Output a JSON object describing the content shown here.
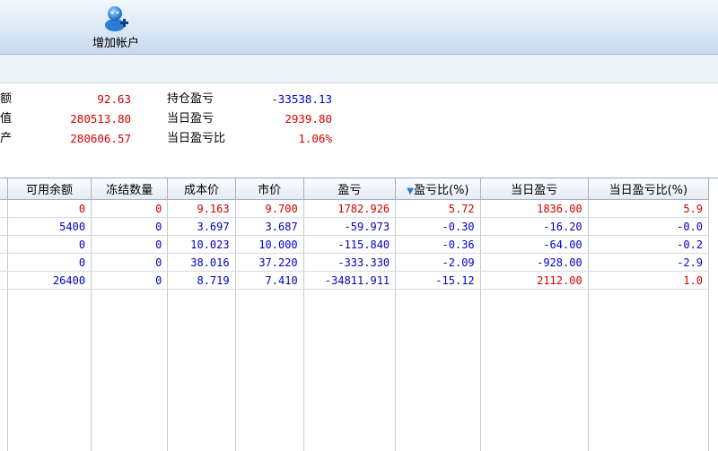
{
  "toolbar": {
    "add_account_label": "增加帐户",
    "add_account_icon": "user-add-icon"
  },
  "summary": {
    "left": [
      {
        "label": "额",
        "value": "92.63",
        "color": "red"
      },
      {
        "label": "值",
        "value": "280513.80",
        "color": "red"
      },
      {
        "label": "产",
        "value": "280606.57",
        "color": "red"
      }
    ],
    "right": [
      {
        "label": "持仓盈亏",
        "value": "-33538.13",
        "color": "blue"
      },
      {
        "label": "当日盈亏",
        "value": "2939.80",
        "color": "red"
      },
      {
        "label": "当日盈亏比",
        "value": "1.06%",
        "color": "red"
      }
    ]
  },
  "table": {
    "columns": [
      "",
      "可用余额",
      "冻结数量",
      "成本价",
      "市价",
      "盈亏",
      "盈亏比(%)",
      "当日盈亏",
      "当日盈亏比(%)"
    ],
    "sort_column": 6,
    "sort_indicator": "▼",
    "rows": [
      {
        "color": "red",
        "cells": [
          "",
          "0",
          "0",
          "9.163",
          "9.700",
          "1782.926",
          "5.72",
          "1836.00",
          "5.9"
        ]
      },
      {
        "color": "blue",
        "cells": [
          "",
          "5400",
          "0",
          "3.697",
          "3.687",
          "-59.973",
          "-0.30",
          "-16.20",
          "-0.0"
        ]
      },
      {
        "color": "blue",
        "cells": [
          "",
          "0",
          "0",
          "10.023",
          "10.000",
          "-115.840",
          "-0.36",
          "-64.00",
          "-0.2"
        ]
      },
      {
        "color": "blue",
        "cells": [
          "",
          "0",
          "0",
          "38.016",
          "37.220",
          "-333.330",
          "-2.09",
          "-928.00",
          "-2.9"
        ]
      },
      {
        "color": "blue",
        "cells": [
          "",
          "26400",
          "0",
          "8.719",
          "7.410",
          "-34811.911",
          "-15.12",
          "2112.00",
          "1.0"
        ]
      }
    ],
    "mixed_row": {
      "index": 4,
      "red_from_column": 7
    }
  },
  "colors": {
    "red": "#d40000",
    "blue": "#0000c8",
    "toolbar": "#dfeaf6",
    "header": "#e4ebf3"
  }
}
